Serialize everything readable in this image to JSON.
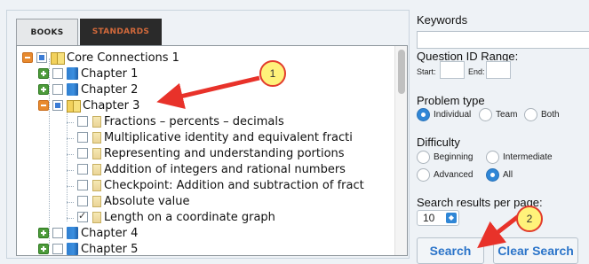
{
  "tabs": {
    "books": "BOOKS",
    "standards": "STANDARDS"
  },
  "tree": {
    "root": "Core Connections 1",
    "chapter1": "Chapter 1",
    "chapter2": "Chapter 2",
    "chapter3": "Chapter 3",
    "sections": [
      "Fractions – percents – decimals",
      "Multiplicative identity and equivalent fracti",
      "Representing and understanding portions",
      "Addition of integers and rational numbers",
      "Checkpoint: Addition and subtraction of fract",
      "Absolute value",
      "Length on a coordinate graph"
    ],
    "chapter4": "Chapter 4",
    "chapter5": "Chapter 5"
  },
  "right": {
    "keywords_label": "Keywords",
    "keywords_value": "",
    "qid_label": "Question ID Range:",
    "start_label": "Start:",
    "end_label": "End:",
    "start_value": "",
    "end_value": "",
    "problem_type_label": "Problem type",
    "problem_types": [
      "Individual",
      "Team",
      "Both"
    ],
    "difficulty_label": "Difficulty",
    "difficulties": [
      "Beginning",
      "Intermediate",
      "Advanced",
      "All"
    ],
    "per_page_label": "Search results per page:",
    "per_page_value": "10",
    "search_button": "Search",
    "clear_button": "Clear Search"
  },
  "callouts": {
    "one": "1",
    "two": "2"
  },
  "colors": {
    "accent": "#2b74c9",
    "callout_fill": "#fff27a",
    "callout_stroke": "#e23c2c",
    "arrow": "#e8322a"
  }
}
